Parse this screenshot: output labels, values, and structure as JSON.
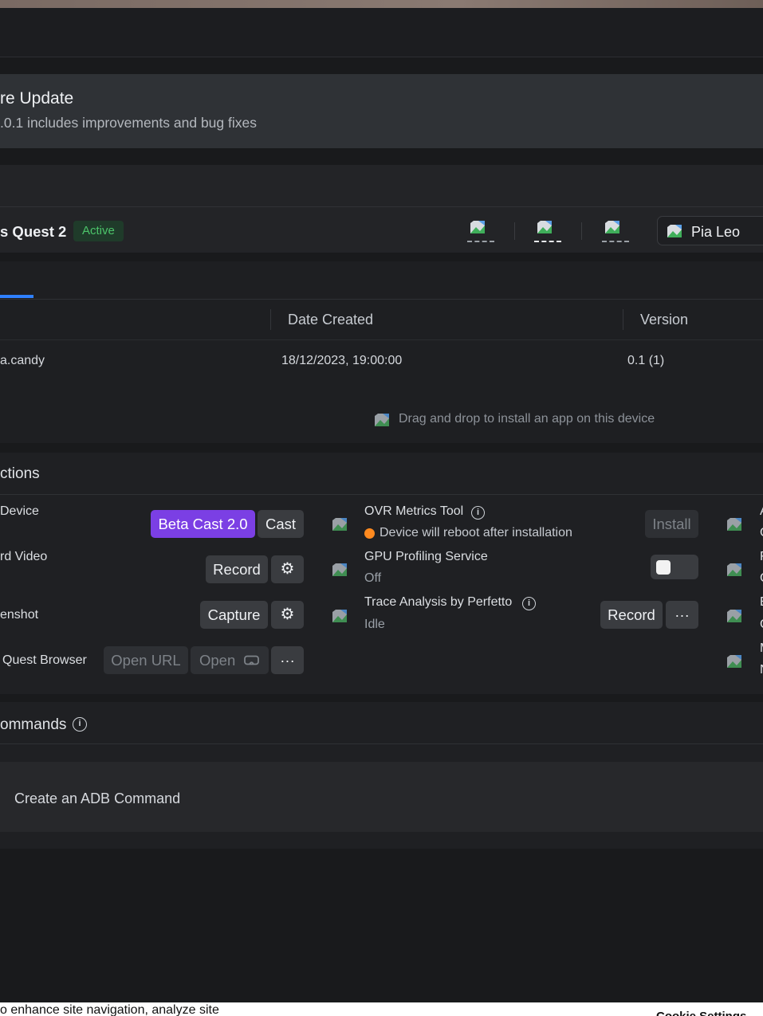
{
  "update": {
    "title": "re Update",
    "subtitle": ".0.1 includes improvements and bug fixes"
  },
  "device": {
    "name": "s Quest 2",
    "status": "Active",
    "user": "Pia Leo"
  },
  "apps": {
    "columns": [
      "Date Created",
      "Version"
    ],
    "rows": [
      {
        "name": "a.candy",
        "date": "18/12/2023, 19:00:00",
        "version": "0.1 (1)"
      }
    ],
    "drop_hint": "Drag and drop to install an app on this device"
  },
  "actions": {
    "heading": "ctions",
    "cast": {
      "label": "Device",
      "beta_button": "Beta Cast 2.0",
      "cast_button": "Cast"
    },
    "record": {
      "label": "rd Video",
      "button": "Record"
    },
    "screenshot": {
      "label": "enshot",
      "button": "Capture"
    },
    "browser": {
      "label": "Quest Browser",
      "open_url": "Open URL",
      "open": "Open",
      "more": "···"
    },
    "ovr": {
      "label": "OVR Metrics Tool",
      "note": "Device will reboot after installation",
      "button": "Install"
    },
    "gpu": {
      "label": "GPU Profiling Service",
      "state": "Off"
    },
    "trace": {
      "label": "Trace Analysis by Perfetto",
      "state": "Idle",
      "button": "Record",
      "more": "···"
    },
    "right_edge": [
      "A",
      "C",
      "F",
      "C",
      "E",
      "C",
      "M",
      "N"
    ]
  },
  "commands": {
    "heading": "ommands",
    "create": "Create an ADB Command"
  },
  "cookie": {
    "text": "o enhance site navigation, analyze site",
    "settings": "Cookie Settings"
  }
}
